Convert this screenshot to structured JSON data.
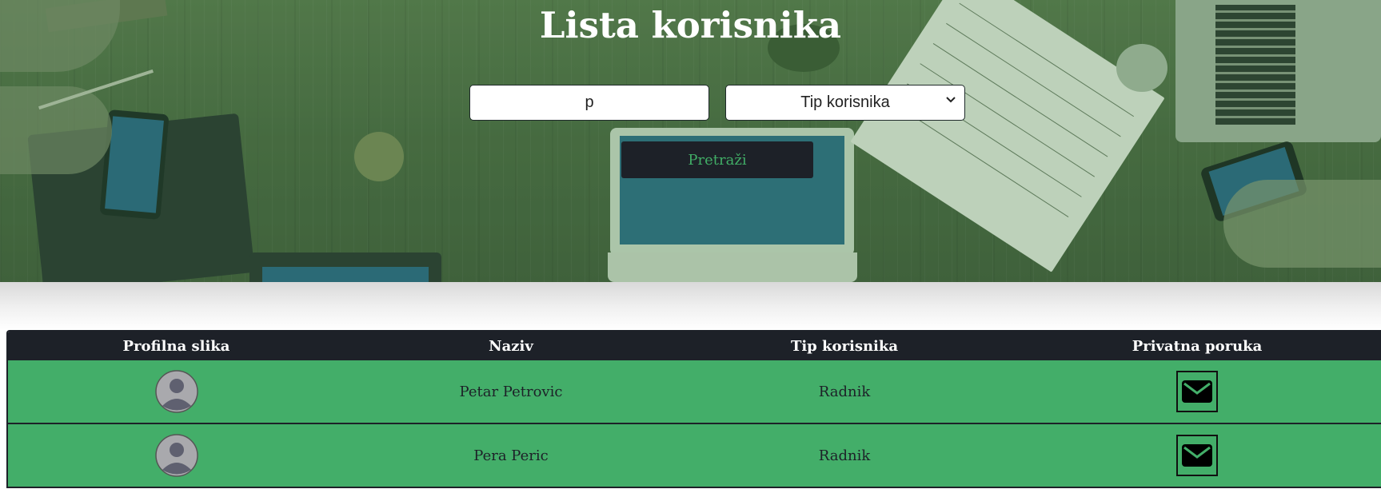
{
  "header": {
    "title": "Lista korisnika"
  },
  "search": {
    "value": "p",
    "placeholder": ""
  },
  "type_select": {
    "selected": "Tip korisnika"
  },
  "search_button": {
    "label": "Pretraži"
  },
  "table": {
    "columns": [
      "Profilna slika",
      "Naziv",
      "Tip korisnika",
      "Privatna poruka"
    ],
    "rows": [
      {
        "avatar_icon": "user-avatar-icon",
        "name": "Petar Petrovic",
        "type": "Radnik",
        "message_icon": "envelope-icon"
      },
      {
        "avatar_icon": "user-avatar-icon",
        "name": "Pera Peric",
        "type": "Radnik",
        "message_icon": "envelope-icon"
      }
    ]
  },
  "colors": {
    "accent_green": "#43ae69",
    "dark": "#1d2128",
    "button_text": "#41ad66"
  }
}
